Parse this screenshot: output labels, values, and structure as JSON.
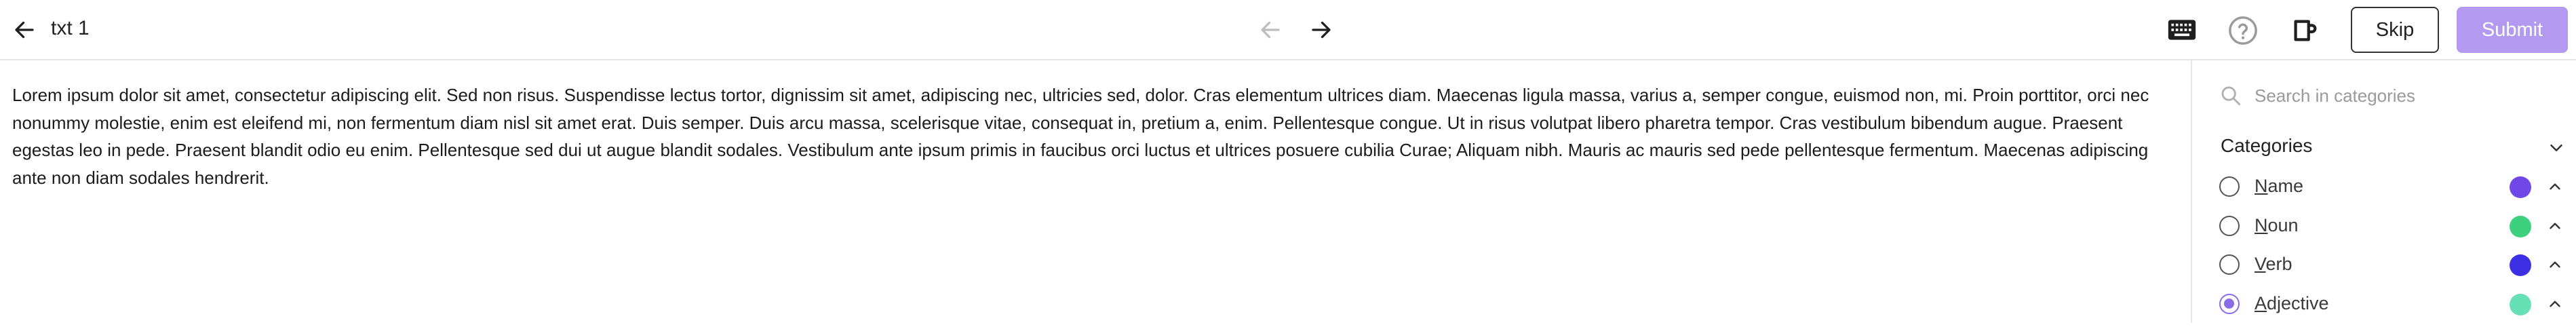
{
  "header": {
    "doc_title": "txt 1",
    "skip_label": "Skip",
    "submit_label": "Submit",
    "icons": [
      "arrow-left-icon",
      "arrow-prev-icon",
      "arrow-next-icon",
      "keyboard-icon",
      "help-icon",
      "cup-icon"
    ]
  },
  "document": {
    "text": "Lorem ipsum dolor sit amet, consectetur adipiscing elit. Sed non risus. Suspendisse lectus tortor, dignissim sit amet, adipiscing nec, ultricies sed, dolor. Cras elementum ultrices diam. Maecenas ligula massa, varius a, semper congue, euismod non, mi. Proin porttitor, orci nec nonummy molestie, enim est eleifend mi, non fermentum diam nisl sit amet erat. Duis semper. Duis arcu massa, scelerisque vitae, consequat in, pretium a, enim. Pellentesque congue. Ut in risus volutpat libero pharetra tempor. Cras vestibulum bibendum augue. Praesent egestas leo in pede. Praesent blandit odio eu enim. Pellentesque sed dui ut augue blandit sodales. Vestibulum ante ipsum primis in faucibus orci luctus et ultrices posuere cubilia Curae; Aliquam nibh. Mauris ac mauris sed pede pellentesque fermentum. Maecenas adipiscing ante non diam sodales hendrerit."
  },
  "sidebar": {
    "search_placeholder": "Search in categories",
    "categories_title": "Categories",
    "categories": [
      {
        "label": "Name",
        "hotkey": "N",
        "rest": "ame",
        "color": "#7048e8",
        "selected": false
      },
      {
        "label": "Noun",
        "hotkey": "N",
        "rest": "oun",
        "color": "#3dd17f",
        "selected": false
      },
      {
        "label": "Verb",
        "hotkey": "V",
        "rest": "erb",
        "color": "#3d2fe3",
        "selected": false
      },
      {
        "label": "Adjective",
        "hotkey": "A",
        "rest": "djective",
        "color": "#66e0b5",
        "selected": true
      }
    ]
  },
  "colors": {
    "accent": "#8c6be8",
    "submit_bg": "#b39af0",
    "border": "#e6e6e6"
  }
}
